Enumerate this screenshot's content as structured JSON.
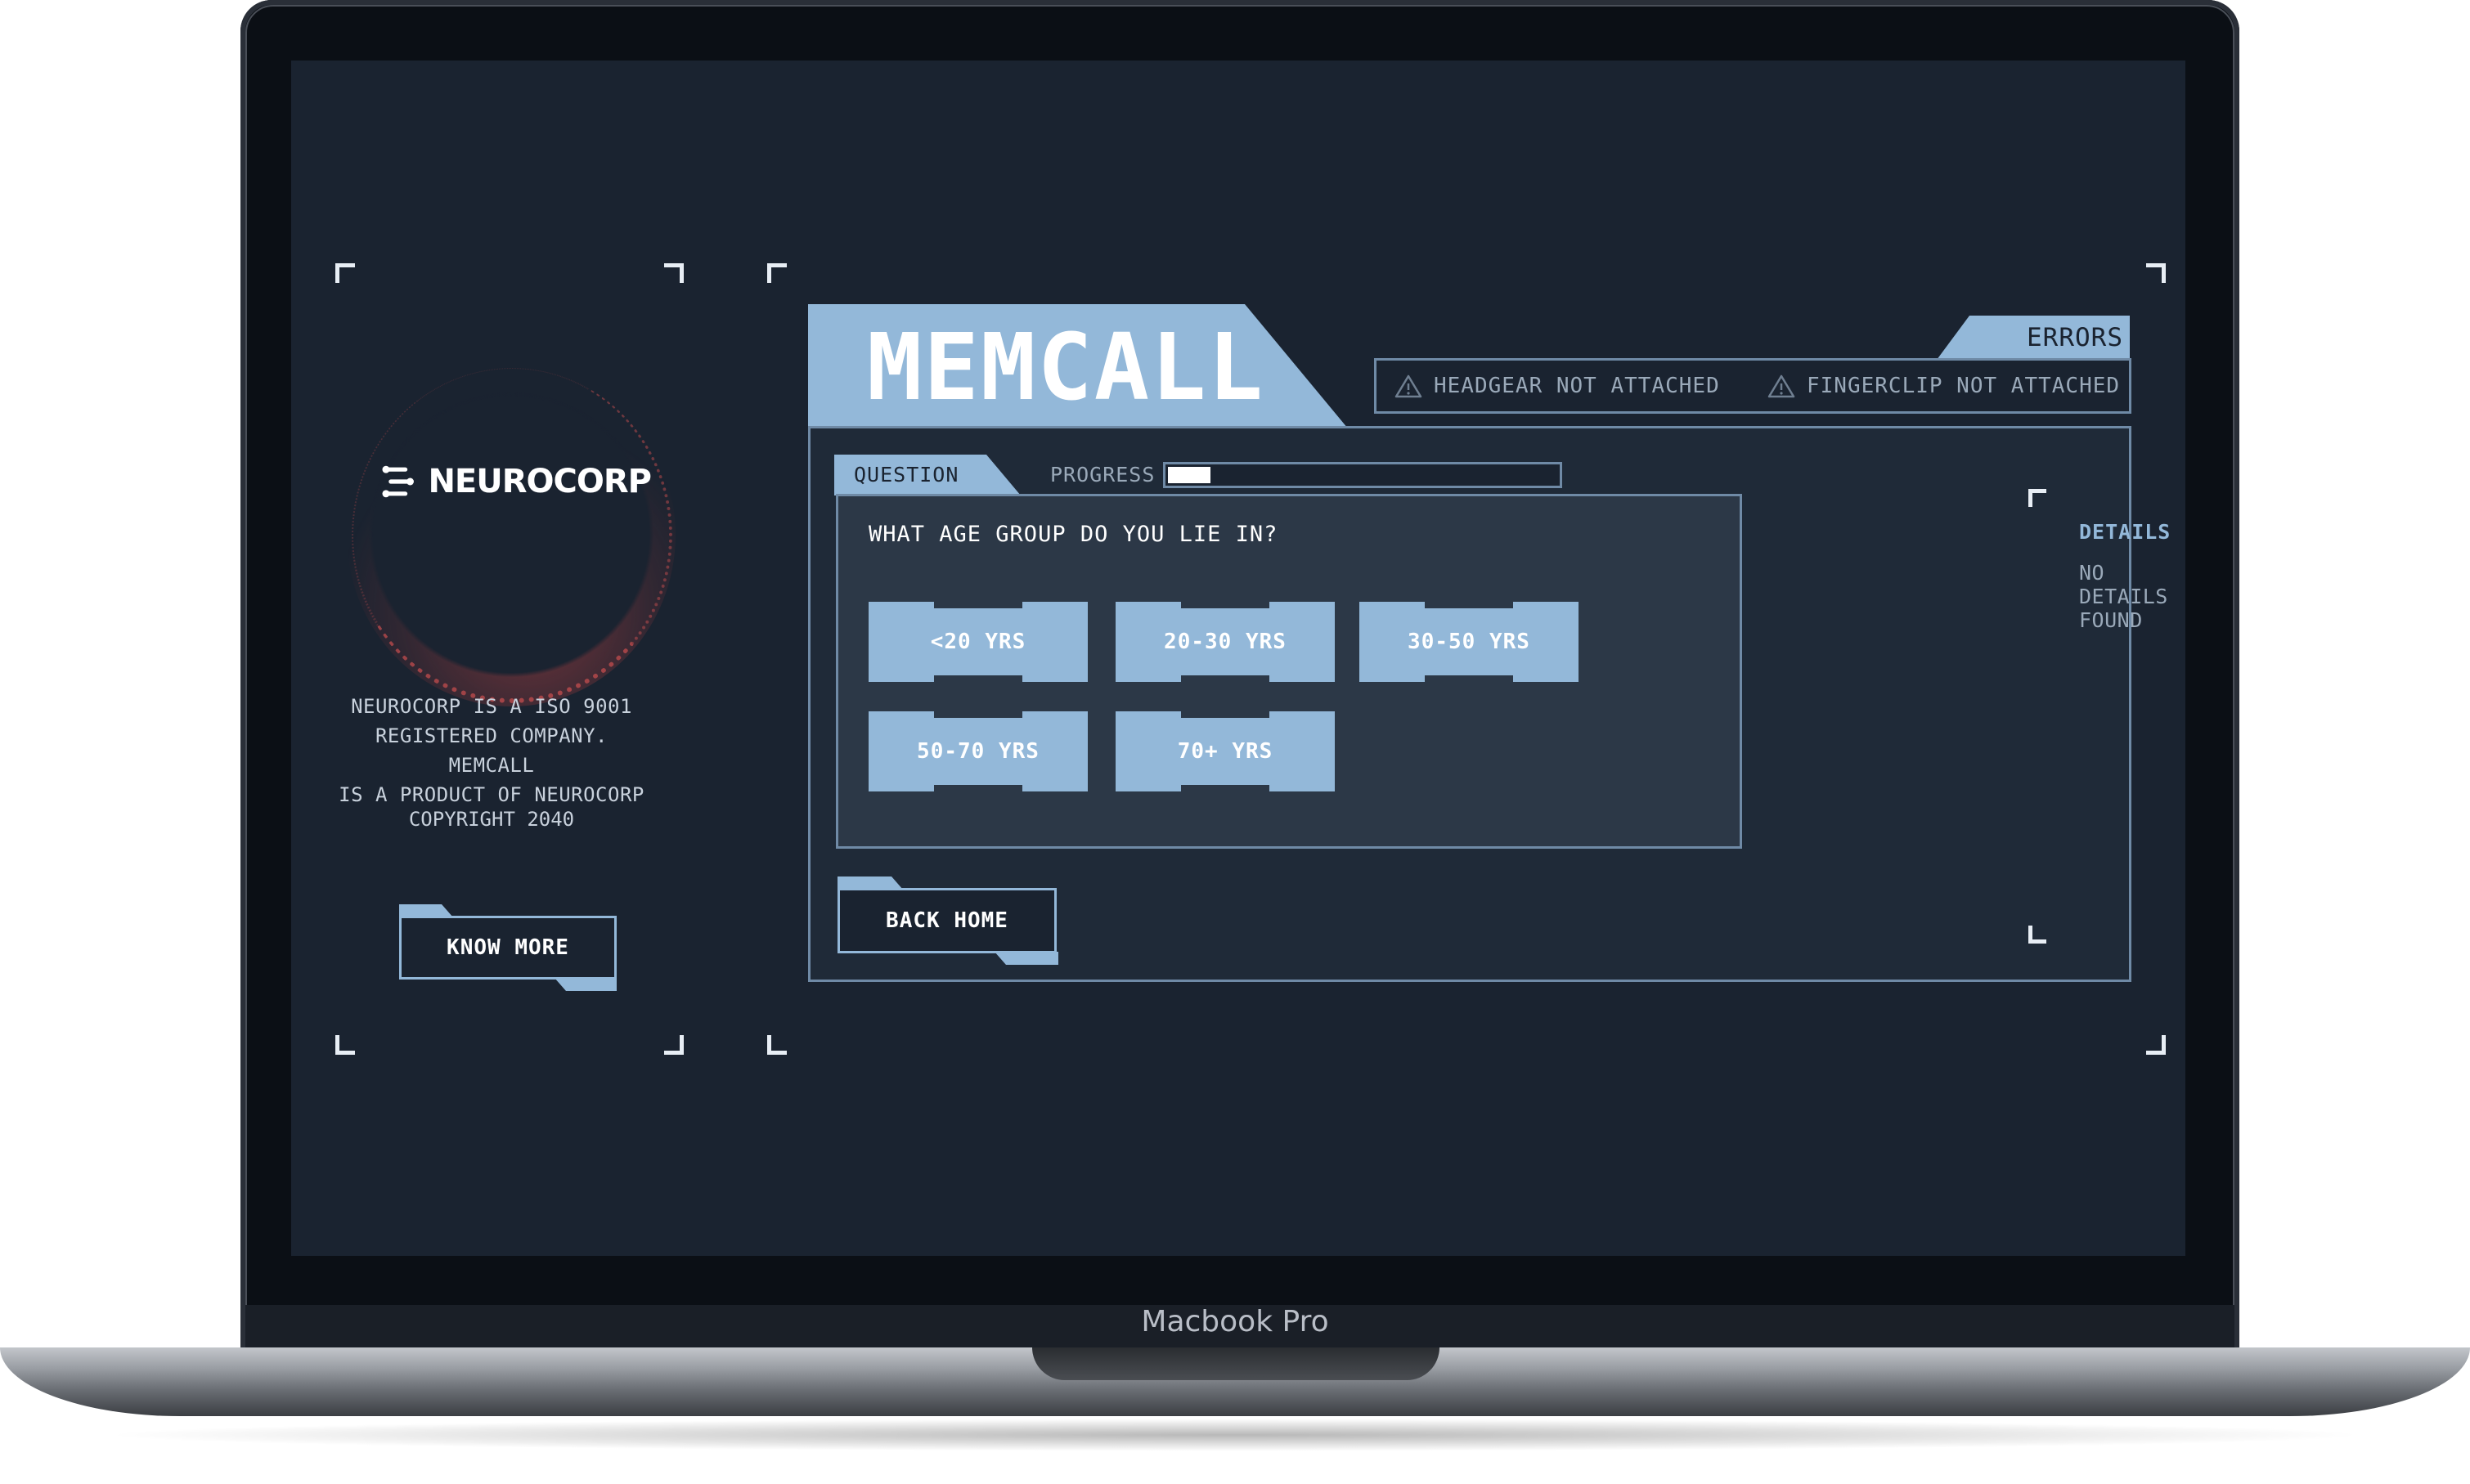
{
  "device": {
    "model_label": "Macbook Pro"
  },
  "brand": {
    "name": "NEUROCORP",
    "about_lines": [
      "NEUROCORP IS A ISO 9001",
      "REGISTERED COMPANY. MEMCALL",
      "IS A PRODUCT OF NEUROCORP"
    ],
    "copyright": "COPYRIGHT 2040",
    "know_more_label": "KNOW MORE"
  },
  "app": {
    "title": "MEMCALL"
  },
  "errors": {
    "label": "ERRORS",
    "items": [
      {
        "icon": "warning-icon",
        "text": "HEADGEAR NOT ATTACHED"
      },
      {
        "icon": "warning-icon",
        "text": "FINGERCLIP NOT ATTACHED"
      }
    ]
  },
  "quiz": {
    "tab_label": "QUESTION",
    "progress_label": "PROGRESS",
    "progress_value": 0.11,
    "question": "WHAT AGE GROUP DO YOU LIE IN?",
    "options": [
      "<20 YRS",
      "20-30 YRS",
      "30-50 YRS",
      "50-70 YRS",
      "70+ YRS"
    ],
    "back_label": "BACK HOME"
  },
  "details": {
    "heading": "DETAILS",
    "text": "NO DETAILS FOUND"
  },
  "colors": {
    "screen_bg": "#1a2330",
    "accent": "#93b8d9",
    "outline": "#6f8aa6",
    "globe_red": "#c44444"
  }
}
